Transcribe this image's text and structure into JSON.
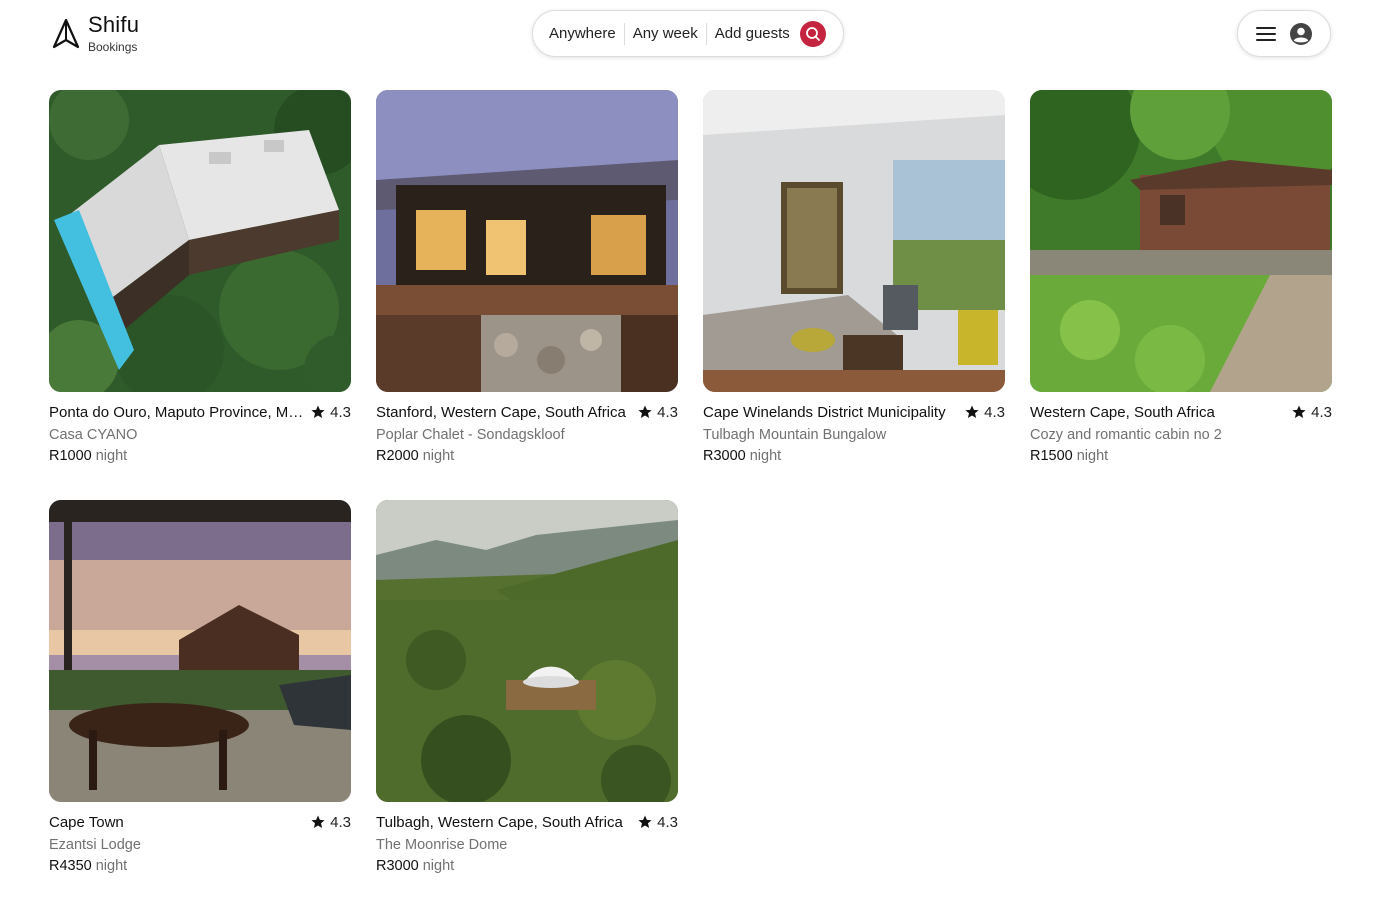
{
  "brand": {
    "title": "Shifu",
    "subtitle": "Bookings"
  },
  "search": {
    "anywhere": "Anywhere",
    "week": "Any week",
    "guests": "Add guests"
  },
  "colors": {
    "accent": "#c4243f",
    "muted": "#717171"
  },
  "listings": [
    {
      "location": "Ponta do Ouro, Maputo Province, Mozambique",
      "rating": "4.3",
      "name": "Casa CYANO",
      "price": "R1000",
      "per": "night"
    },
    {
      "location": "Stanford, Western Cape, South Africa",
      "rating": "4.3",
      "name": "Poplar Chalet - Sondagskloof",
      "price": "R2000",
      "per": "night"
    },
    {
      "location": "Cape Winelands District Municipality",
      "rating": "4.3",
      "name": "Tulbagh Mountain Bungalow",
      "price": "R3000",
      "per": "night"
    },
    {
      "location": "Western Cape, South Africa",
      "rating": "4.3",
      "name": "Cozy and romantic cabin no 2",
      "price": "R1500",
      "per": "night"
    },
    {
      "location": "Cape Town",
      "rating": "4.3",
      "name": "Ezantsi Lodge",
      "price": "R4350",
      "per": "night"
    },
    {
      "location": "Tulbagh, Western Cape, South Africa",
      "rating": "4.3",
      "name": "The Moonrise Dome",
      "price": "R3000",
      "per": "night"
    }
  ]
}
